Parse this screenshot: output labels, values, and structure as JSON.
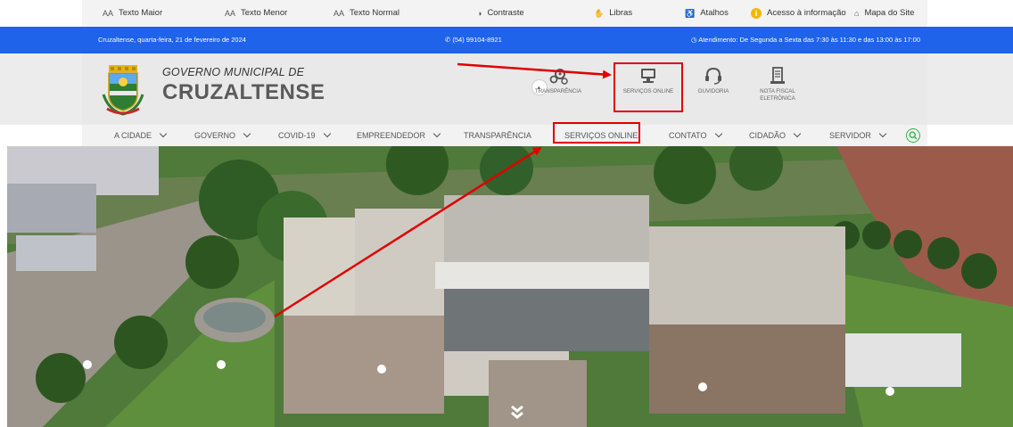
{
  "accessibility_bar": {
    "texto_maior": "Texto Maior",
    "texto_menor": "Texto Menor",
    "texto_normal": "Texto Normal",
    "contraste": "Contraste",
    "libras": "Libras",
    "atalhos": "Atalhos",
    "acesso_info": "Acesso à informação",
    "mapa_site": "Mapa do Site",
    "font_icon_text": "AA"
  },
  "info_bar": {
    "date": "Cruzaltense, quarta-feira, 21 de fevereiro de 2024",
    "phone": "(54) 99104-8921",
    "hours": "Atendimento: De Segunda a Sexta das 7:30 às 11:30 e das 13:00 às 17:00"
  },
  "header": {
    "title_line1": "GOVERNO MUNICIPAL DE",
    "title_line2": "CRUZALTENSE"
  },
  "quick_links": [
    {
      "label": "TRANSPARÊNCIA",
      "icon": "gears-icon"
    },
    {
      "label": "SERVIÇOS ONLINE",
      "icon": "computer-icon"
    },
    {
      "label": "OUVIDORIA",
      "icon": "headset-icon"
    },
    {
      "label": "NOTA FISCAL ELETRÔNICA",
      "icon": "receipt-icon"
    }
  ],
  "nav": [
    {
      "label": "A CIDADE",
      "dropdown": true
    },
    {
      "label": "GOVERNO",
      "dropdown": true
    },
    {
      "label": "COVID-19",
      "dropdown": true
    },
    {
      "label": "EMPREENDEDOR",
      "dropdown": true
    },
    {
      "label": "TRANSPARÊNCIA",
      "dropdown": false
    },
    {
      "label": "SERVIÇOS ONLINE",
      "dropdown": false
    },
    {
      "label": "CONTATO",
      "dropdown": true
    },
    {
      "label": "CIDADÃO",
      "dropdown": true
    },
    {
      "label": "SERVIDOR",
      "dropdown": true
    }
  ],
  "colors": {
    "info_bar": "#1e63e9",
    "annotation": "#e00000",
    "search_accent": "#2fb54a"
  }
}
